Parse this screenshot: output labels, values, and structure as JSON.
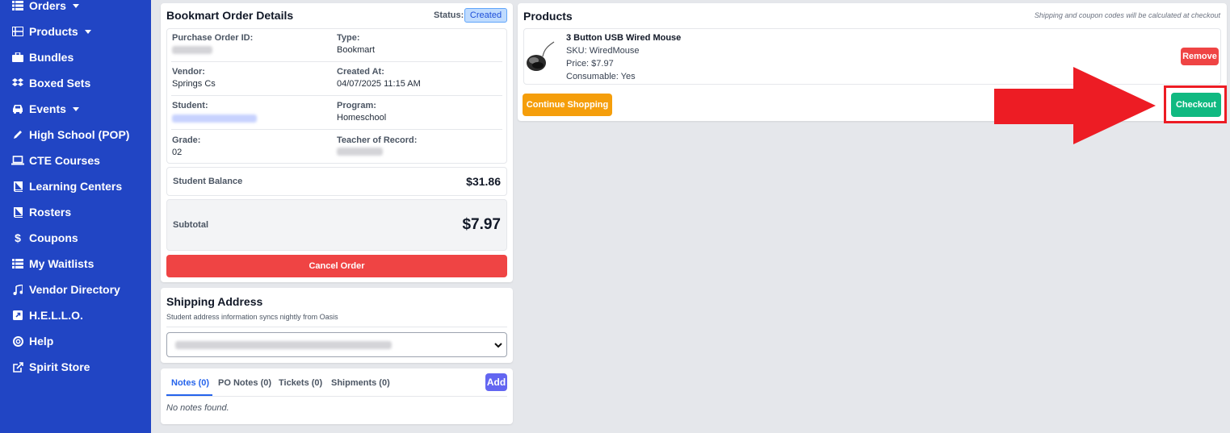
{
  "sidebar": {
    "items": [
      {
        "label": "Orders",
        "icon": "list-icon",
        "caret": true
      },
      {
        "label": "Products",
        "icon": "grid-list-icon",
        "caret": true
      },
      {
        "label": "Bundles",
        "icon": "briefcase-icon",
        "caret": false
      },
      {
        "label": "Boxed Sets",
        "icon": "dropbox-icon",
        "caret": false
      },
      {
        "label": "Events",
        "icon": "car-icon",
        "caret": true
      },
      {
        "label": "High School (POP)",
        "icon": "pencil-icon",
        "caret": false
      },
      {
        "label": "CTE Courses",
        "icon": "laptop-icon",
        "caret": false
      },
      {
        "label": "Learning Centers",
        "icon": "book-icon",
        "caret": false
      },
      {
        "label": "Rosters",
        "icon": "book-icon",
        "caret": false
      },
      {
        "label": "Coupons",
        "icon": "dollar-icon",
        "caret": false
      },
      {
        "label": "My Waitlists",
        "icon": "list-icon",
        "caret": false
      },
      {
        "label": "Vendor Directory",
        "icon": "music-icon",
        "caret": false
      },
      {
        "label": "H.E.L.L.O.",
        "icon": "external-square-icon",
        "caret": false
      },
      {
        "label": "Help",
        "icon": "lifebuoy-icon",
        "caret": false
      },
      {
        "label": "Spirit Store",
        "icon": "external-link-icon",
        "caret": false
      }
    ]
  },
  "order": {
    "title": "Bookmart Order Details",
    "status_label": "Status:",
    "status": "Created",
    "fields": {
      "po_label": "Purchase Order ID:",
      "type_label": "Type:",
      "type": "Bookmart",
      "vendor_label": "Vendor:",
      "vendor": "Springs Cs",
      "created_label": "Created At:",
      "created": "04/07/2025 11:15 AM",
      "student_label": "Student:",
      "program_label": "Program:",
      "program": "Homeschool",
      "grade_label": "Grade:",
      "grade": "02",
      "teacher_label": "Teacher of Record:"
    },
    "balance_label": "Student Balance",
    "balance": "$31.86",
    "subtotal_label": "Subtotal",
    "subtotal": "$7.97",
    "cancel_label": "Cancel Order"
  },
  "shipping": {
    "title": "Shipping Address",
    "subtitle": "Student address information syncs nightly from Oasis"
  },
  "notes": {
    "tabs": [
      "Notes (0)",
      "PO Notes (0)",
      "Tickets (0)",
      "Shipments (0)"
    ],
    "add_label": "Add",
    "empty": "No notes found."
  },
  "products": {
    "title": "Products",
    "note": "Shipping and coupon codes will be calculated at checkout",
    "item": {
      "name": "3 Button USB Wired Mouse",
      "sku": "SKU: WiredMouse",
      "price": "Price: $7.97",
      "consumable": "Consumable: Yes"
    },
    "remove_label": "Remove",
    "continue_label": "Continue Shopping",
    "checkout_label": "Checkout"
  },
  "colors": {
    "sidebar": "#2145c4",
    "cancel": "#ef4444",
    "remove": "#ef4444",
    "continue": "#f59e0b",
    "checkout": "#10b981",
    "annotation": "#ed1c24"
  }
}
